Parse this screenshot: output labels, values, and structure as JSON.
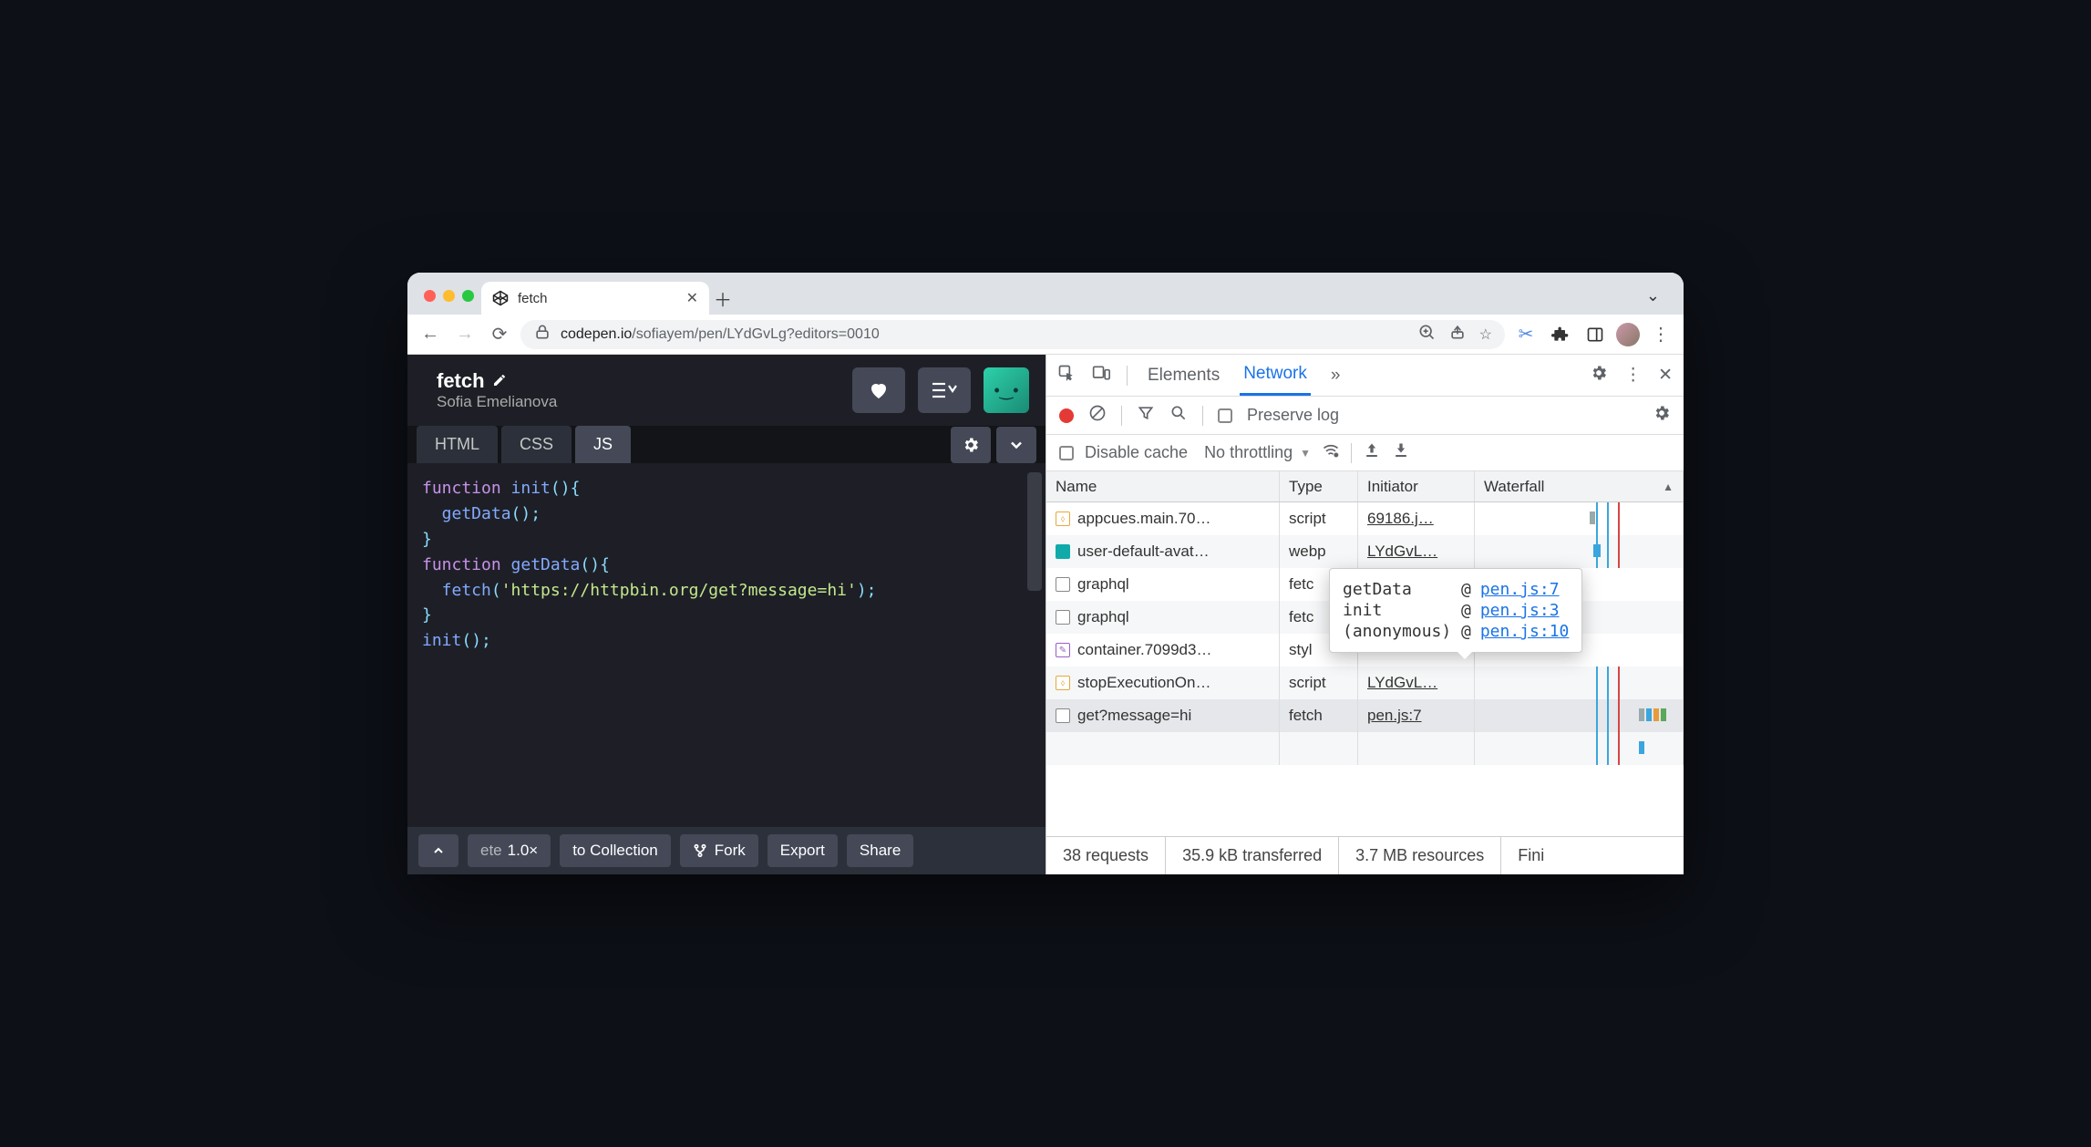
{
  "browser": {
    "tab_title": "fetch",
    "url_host": "codepen.io",
    "url_path": "/sofiayem/pen/LYdGvLg?editors=0010"
  },
  "codepen": {
    "title": "fetch",
    "author": "Sofia Emelianova",
    "tabs": {
      "html": "HTML",
      "css": "CSS",
      "js": "JS"
    },
    "code": {
      "l1a": "function",
      "l1b": " init",
      "l1c": "(){",
      "l2a": "  getData",
      "l2b": "();",
      "l3": "}",
      "l4": "",
      "l5a": "function",
      "l5b": " getData",
      "l5c": "(){",
      "l6a": "  fetch",
      "l6b": "(",
      "l6c": "'https://httpbin.org/get?message=hi'",
      "l6d": ");",
      "l7": "}",
      "l8": "",
      "l9a": "init",
      "l9b": "();"
    },
    "footer": {
      "zoom_partial": "ete",
      "zoom": "1.0×",
      "collection": "to Collection",
      "fork": "Fork",
      "export": "Export",
      "share": "Share"
    }
  },
  "devtools": {
    "tabs": {
      "elements": "Elements",
      "network": "Network",
      "more": "»"
    },
    "preserve_log": "Preserve log",
    "disable_cache": "Disable cache",
    "throttling": "No throttling",
    "columns": {
      "name": "Name",
      "type": "Type",
      "initiator": "Initiator",
      "waterfall": "Waterfall"
    },
    "rows": [
      {
        "name": "appcues.main.70…",
        "type": "script",
        "initiator": "69186.j…",
        "icon": "js"
      },
      {
        "name": "user-default-avat…",
        "type": "webp",
        "initiator": "LYdGvL…",
        "icon": "img"
      },
      {
        "name": "graphql",
        "type": "fetc",
        "initiator": "",
        "icon": "blank"
      },
      {
        "name": "graphql",
        "type": "fetc",
        "initiator": "",
        "icon": "blank"
      },
      {
        "name": "container.7099d3…",
        "type": "styl",
        "initiator": "",
        "icon": "css"
      },
      {
        "name": "stopExecutionOn…",
        "type": "script",
        "initiator": "LYdGvL…",
        "icon": "js"
      },
      {
        "name": "get?message=hi",
        "type": "fetch",
        "initiator": "pen.js:7",
        "icon": "blank"
      }
    ],
    "tooltip": [
      {
        "fn": "getData",
        "at": "@",
        "loc": "pen.js:7"
      },
      {
        "fn": "init",
        "at": "@",
        "loc": "pen.js:3"
      },
      {
        "fn": "(anonymous)",
        "at": "@",
        "loc": "pen.js:10"
      }
    ],
    "status": {
      "requests": "38 requests",
      "transferred": "35.9 kB transferred",
      "resources": "3.7 MB resources",
      "finish": "Fini"
    }
  }
}
